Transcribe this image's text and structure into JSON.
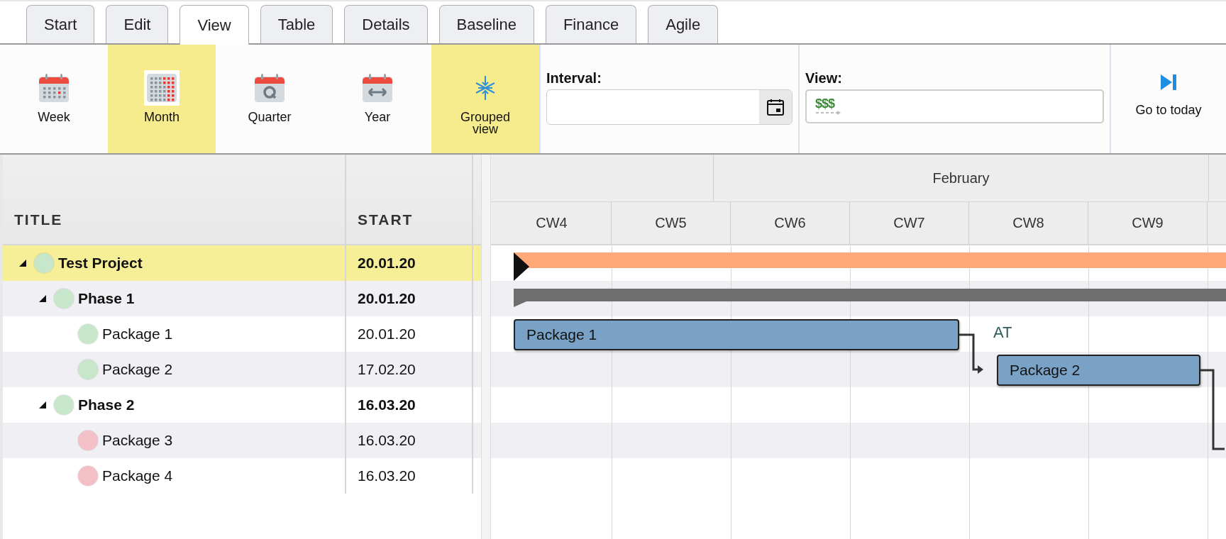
{
  "tabs": [
    {
      "label": "Start",
      "selected": false
    },
    {
      "label": "Edit",
      "selected": false
    },
    {
      "label": "View",
      "selected": true
    },
    {
      "label": "Table",
      "selected": false
    },
    {
      "label": "Details",
      "selected": false
    },
    {
      "label": "Baseline",
      "selected": false
    },
    {
      "label": "Finance",
      "selected": false
    },
    {
      "label": "Agile",
      "selected": false
    }
  ],
  "toolbar": {
    "buttons": [
      {
        "kind": "week",
        "label": "Week",
        "selected": false
      },
      {
        "kind": "month",
        "label": "Month",
        "selected": true
      },
      {
        "kind": "quarter",
        "label": "Quarter",
        "selected": false
      },
      {
        "kind": "year",
        "label": "Year",
        "selected": false
      },
      {
        "kind": "grouped",
        "label": "Grouped view",
        "selected": true
      }
    ],
    "interval": {
      "label": "Interval:"
    },
    "view": {
      "label": "View:",
      "value_symbol": "$$$"
    },
    "go_to_today": {
      "label": "Go to today"
    }
  },
  "table": {
    "columns": [
      "TITLE",
      "START"
    ],
    "rows": [
      {
        "title": "Test Project",
        "start": "20.01.20",
        "kind": "summary",
        "expanded": true,
        "selected": true,
        "color": "#c8e6c9",
        "children": [
          {
            "title": "Phase 1",
            "start": "20.01.20",
            "kind": "summary",
            "expanded": true,
            "selected": false,
            "color": "#c8e6c9",
            "children": [
              {
                "title": "Package 1",
                "start": "20.01.20",
                "kind": "task",
                "selected": false,
                "color": "#c8e6c9"
              },
              {
                "title": "Package 2",
                "start": "17.02.20",
                "kind": "task",
                "selected": false,
                "color": "#c8e6c9"
              }
            ]
          },
          {
            "title": "Phase 2",
            "start": "16.03.20",
            "kind": "summary",
            "expanded": true,
            "selected": false,
            "color": "#c8e6c9",
            "children": [
              {
                "title": "Package 3",
                "start": "16.03.20",
                "kind": "task",
                "selected": false,
                "color": "#f2c0c6"
              },
              {
                "title": "Package 4",
                "start": "16.03.20",
                "kind": "task",
                "selected": false,
                "color": "#f2c0c6"
              }
            ]
          }
        ]
      }
    ]
  },
  "gantt": {
    "month": "February",
    "weeks": [
      "CW4",
      "CW5",
      "CW6",
      "CW7",
      "CW8",
      "CW9"
    ],
    "bars": [
      {
        "kind": "project"
      },
      {
        "kind": "phase"
      },
      {
        "kind": "task",
        "label": "Package 1",
        "note": "AT",
        "successor_link": true
      },
      {
        "kind": "task",
        "label": "Package 2",
        "successor_link": true
      }
    ]
  }
}
